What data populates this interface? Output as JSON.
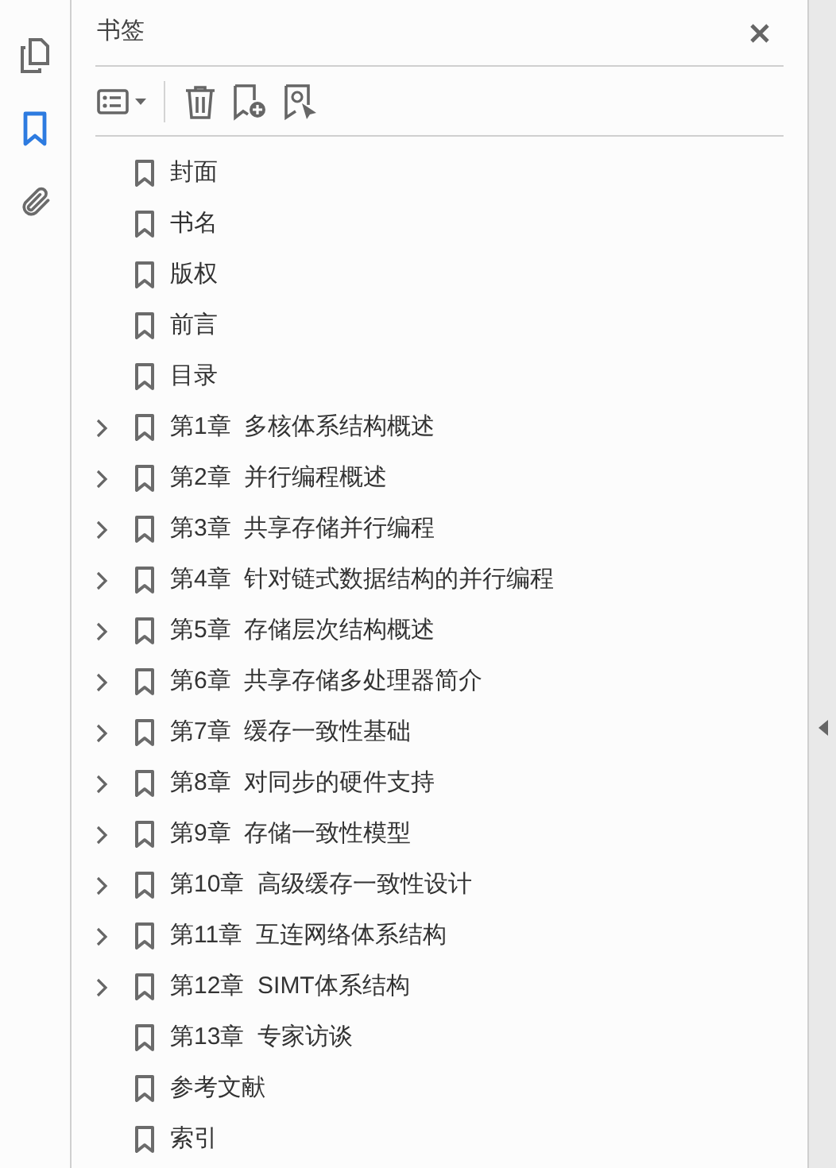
{
  "rail": [
    {
      "kind": "pages",
      "selected": false
    },
    {
      "kind": "bookmarks",
      "selected": true
    },
    {
      "kind": "attachments",
      "selected": false
    }
  ],
  "panel": {
    "title": "书签"
  },
  "bookmarks": [
    {
      "title": "封面",
      "kind": "leaf"
    },
    {
      "title": "书名",
      "kind": "leaf"
    },
    {
      "title": "版权",
      "kind": "leaf"
    },
    {
      "title": "前言",
      "kind": "leaf"
    },
    {
      "title": "目录",
      "kind": "leaf"
    },
    {
      "title": "第1章  多核体系结构概述",
      "kind": "collapsed"
    },
    {
      "title": "第2章  并行编程概述",
      "kind": "collapsed"
    },
    {
      "title": "第3章  共享存储并行编程",
      "kind": "collapsed"
    },
    {
      "title": "第4章  针对链式数据结构的并行编程",
      "kind": "collapsed"
    },
    {
      "title": "第5章  存储层次结构概述",
      "kind": "collapsed"
    },
    {
      "title": "第6章  共享存储多处理器简介",
      "kind": "collapsed"
    },
    {
      "title": "第7章  缓存一致性基础",
      "kind": "collapsed"
    },
    {
      "title": "第8章  对同步的硬件支持",
      "kind": "collapsed"
    },
    {
      "title": "第9章  存储一致性模型",
      "kind": "collapsed"
    },
    {
      "title": "第10章  高级缓存一致性设计",
      "kind": "collapsed"
    },
    {
      "title": "第11章  互连网络体系结构",
      "kind": "collapsed"
    },
    {
      "title": "第12章  SIMT体系结构",
      "kind": "collapsed"
    },
    {
      "title": "第13章  专家访谈",
      "kind": "leaf"
    },
    {
      "title": "参考文献",
      "kind": "leaf"
    },
    {
      "title": "索引",
      "kind": "leaf"
    }
  ]
}
